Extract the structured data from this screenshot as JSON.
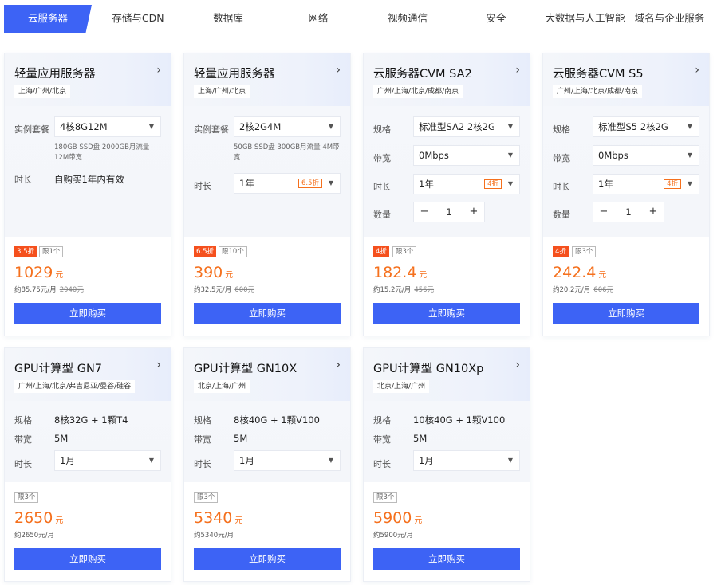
{
  "tabs": [
    "云服务器",
    "存储与CDN",
    "数据库",
    "网络",
    "视频通信",
    "安全",
    "大数据与人工智能",
    "域名与企业服务"
  ],
  "colors": {
    "accent": "#3d63f5",
    "price": "#f5701d",
    "discount_badge": "#f5501d"
  },
  "labels": {
    "spec": "实例套餐",
    "spec2": "规格",
    "duration": "时长",
    "bandwidth": "带宽",
    "quantity": "数量",
    "buy": "立即购买",
    "limit_prefix": "限",
    "chevron": "›",
    "minus": "−",
    "plus": "+",
    "caret": "▼"
  },
  "cards": [
    {
      "title": "轻量应用服务器",
      "regions": "上海/广州/北京",
      "spec": "4核8G12M",
      "spec_note": "180GB SSD盘 2000GB月流量 12M带宽",
      "duration_text": "自购买1年内有效",
      "discount": "3.5折",
      "limit": "限1个",
      "price": "1029",
      "unit": "元",
      "monthly": "约85.75元/月",
      "original": "2940元"
    },
    {
      "title": "轻量应用服务器",
      "regions": "上海/广州/北京",
      "spec": "2核2G4M",
      "spec_note": "50GB SSD盘 300GB月流量 4M带宽",
      "duration": "1年",
      "duration_discount": "6.5折",
      "discount": "6.5折",
      "limit": "限10个",
      "price": "390",
      "unit": "元",
      "monthly": "约32.5元/月",
      "original": "600元"
    },
    {
      "title": "云服务器CVM SA2",
      "regions": "广州/上海/北京/成都/南京",
      "spec": "标准型SA2 2核2G",
      "bandwidth": "0Mbps",
      "duration": "1年",
      "duration_discount": "4折",
      "quantity": "1",
      "discount": "4折",
      "limit": "限3个",
      "price": "182.4",
      "unit": "元",
      "monthly": "约15.2元/月",
      "original": "456元"
    },
    {
      "title": "云服务器CVM S5",
      "regions": "广州/上海/北京/成都/南京",
      "spec": "标准型S5 2核2G",
      "bandwidth": "0Mbps",
      "duration": "1年",
      "duration_discount": "4折",
      "quantity": "1",
      "discount": "4折",
      "limit": "限3个",
      "price": "242.4",
      "unit": "元",
      "monthly": "约20.2元/月",
      "original": "606元"
    },
    {
      "title": "GPU计算型 GN7",
      "regions": "广州/上海/北京/弗吉尼亚/曼谷/硅谷",
      "spec": "8核32G + 1颗T4",
      "bandwidth": "5M",
      "duration": "1月",
      "limit": "限3个",
      "price": "2650",
      "unit": "元",
      "monthly": "约2650元/月"
    },
    {
      "title": "GPU计算型 GN10X",
      "regions": "北京/上海/广州",
      "spec": "8核40G + 1颗V100",
      "bandwidth": "5M",
      "duration": "1月",
      "limit": "限3个",
      "price": "5340",
      "unit": "元",
      "monthly": "约5340元/月"
    },
    {
      "title": "GPU计算型 GN10Xp",
      "regions": "北京/上海/广州",
      "spec": "10核40G + 1颗V100",
      "bandwidth": "5M",
      "duration": "1月",
      "limit": "限3个",
      "price": "5900",
      "unit": "元",
      "monthly": "约5900元/月"
    }
  ]
}
